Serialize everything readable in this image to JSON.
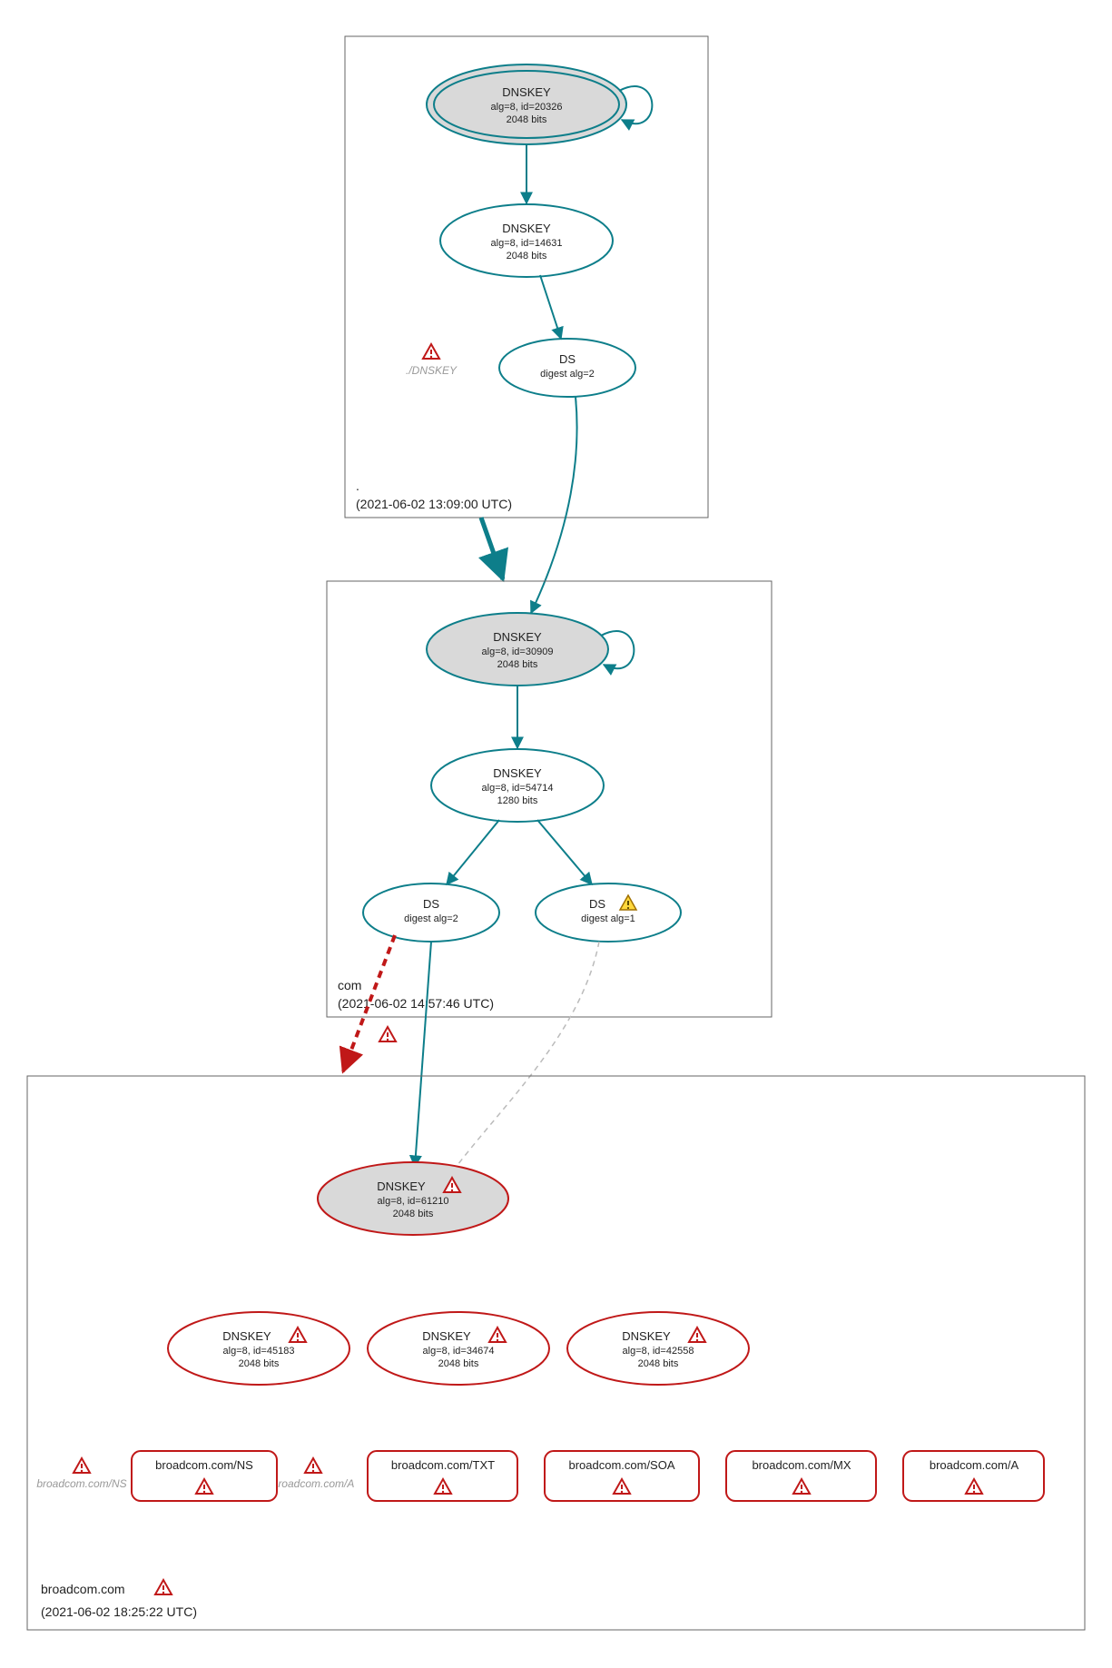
{
  "zones": {
    "root": {
      "name": ".",
      "timestamp": "(2021-06-02 13:09:00 UTC)",
      "ksk": {
        "title": "DNSKEY",
        "line2": "alg=8, id=20326",
        "line3": "2048 bits"
      },
      "zsk": {
        "title": "DNSKEY",
        "line2": "alg=8, id=14631",
        "line3": "2048 bits"
      },
      "ds": {
        "title": "DS",
        "line2": "digest alg=2"
      },
      "missing": "./DNSKEY"
    },
    "com": {
      "name": "com",
      "timestamp": "(2021-06-02 14:57:46 UTC)",
      "ksk": {
        "title": "DNSKEY",
        "line2": "alg=8, id=30909",
        "line3": "2048 bits"
      },
      "zsk": {
        "title": "DNSKEY",
        "line2": "alg=8, id=54714",
        "line3": "1280 bits"
      },
      "ds1": {
        "title": "DS",
        "line2": "digest alg=2"
      },
      "ds2": {
        "title": "DS",
        "line2": "digest alg=1"
      }
    },
    "broadcom": {
      "name": "broadcom.com",
      "timestamp": "(2021-06-02 18:25:22 UTC)",
      "ksk": {
        "title": "DNSKEY",
        "line2": "alg=8, id=61210",
        "line3": "2048 bits"
      },
      "zsk": [
        {
          "title": "DNSKEY",
          "line2": "alg=8, id=45183",
          "line3": "2048 bits"
        },
        {
          "title": "DNSKEY",
          "line2": "alg=8, id=34674",
          "line3": "2048 bits"
        },
        {
          "title": "DNSKEY",
          "line2": "alg=8, id=42558",
          "line3": "2048 bits"
        }
      ],
      "rrsets": [
        "broadcom.com/NS",
        "broadcom.com/TXT",
        "broadcom.com/SOA",
        "broadcom.com/MX",
        "broadcom.com/A"
      ],
      "missing": [
        "broadcom.com/NS",
        "broadcom.com/A"
      ]
    }
  }
}
